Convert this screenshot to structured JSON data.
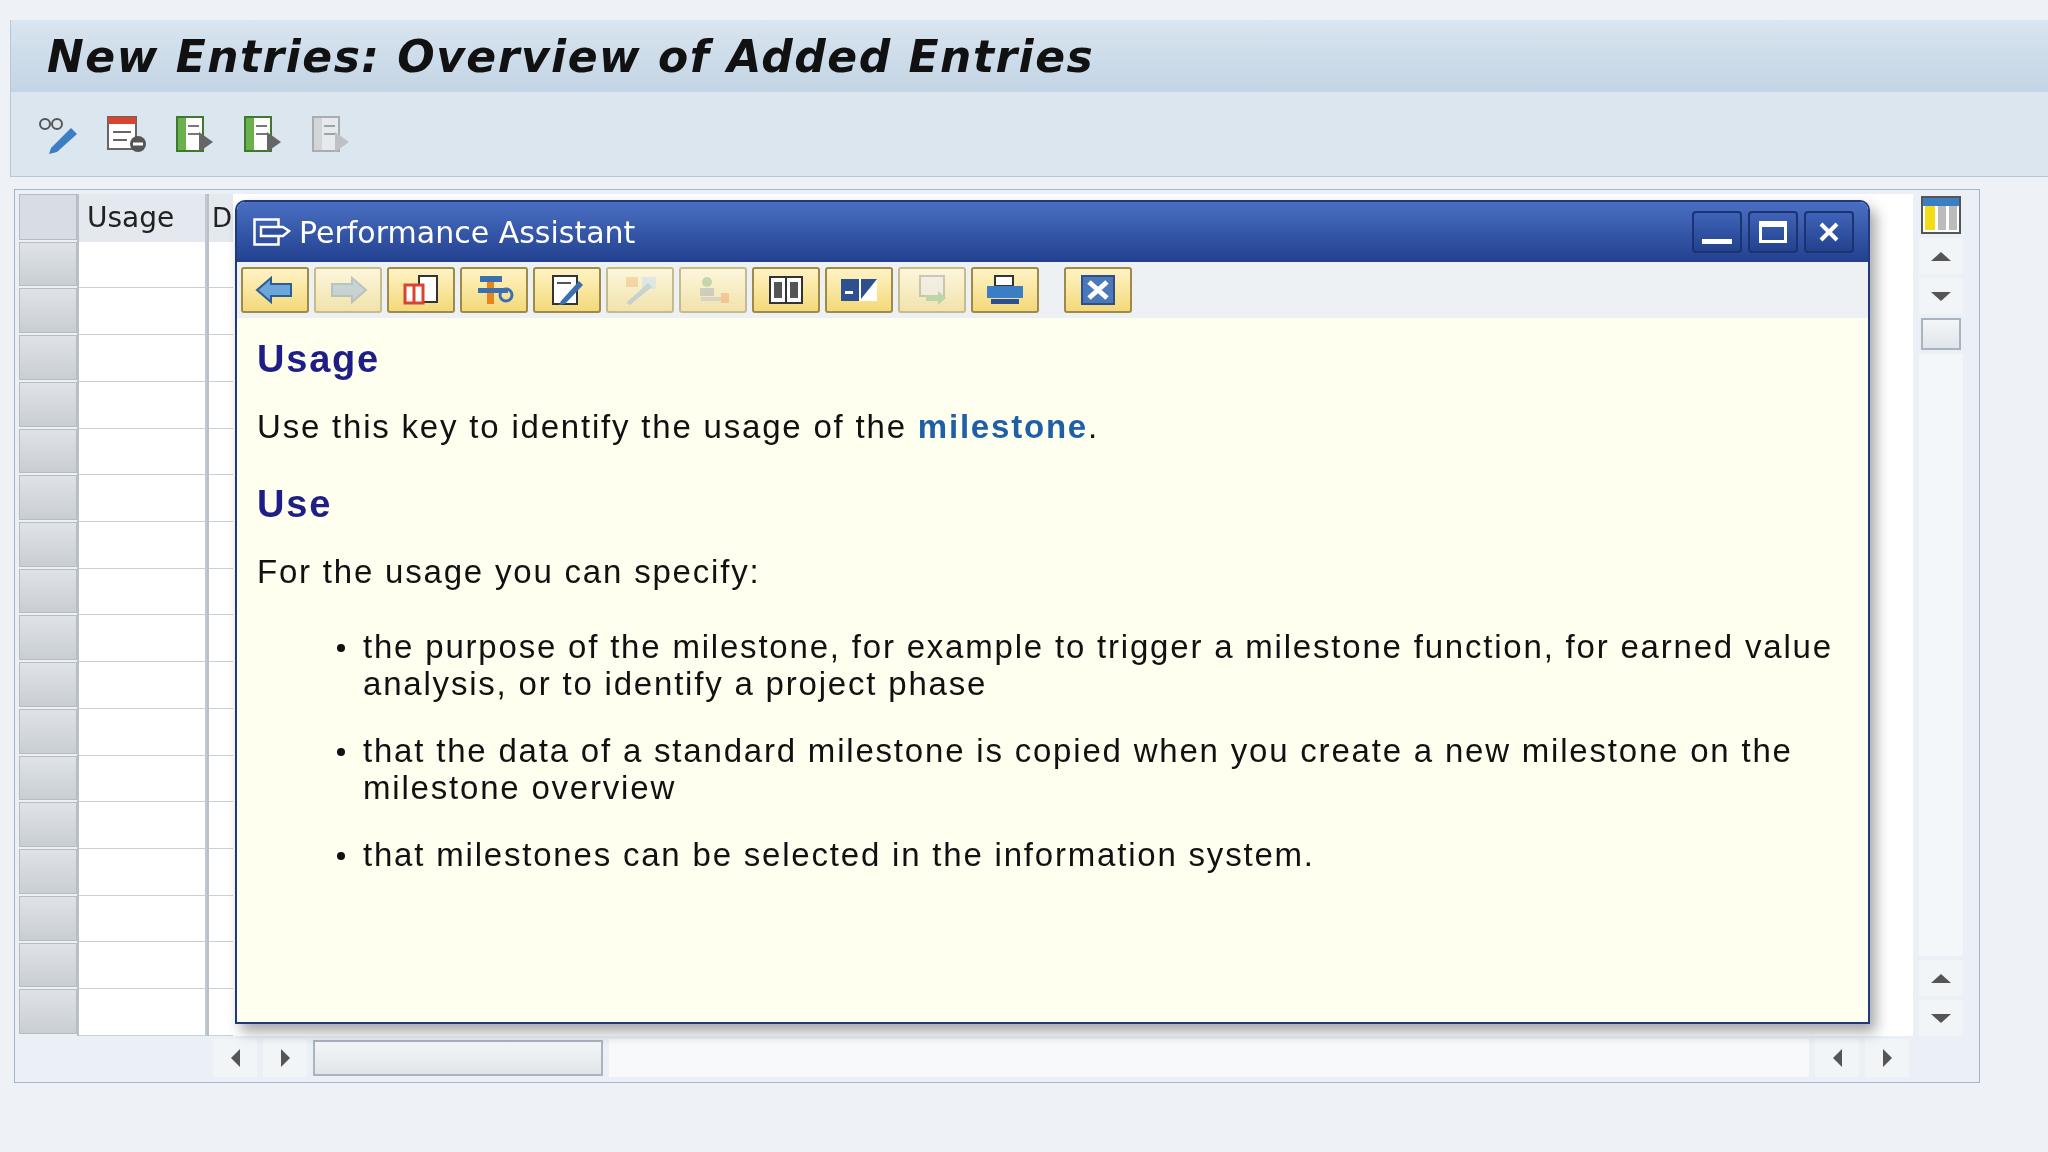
{
  "window": {
    "title": "New Entries: Overview of Added Entries"
  },
  "toolbar": [
    {
      "kind": "glasses-pencil",
      "disabled": false
    },
    {
      "kind": "delete-row",
      "disabled": false
    },
    {
      "kind": "doc-arrow",
      "disabled": false
    },
    {
      "kind": "doc-arrow",
      "disabled": false
    },
    {
      "kind": "doc-arrow",
      "disabled": true
    }
  ],
  "table": {
    "columns": [
      "Usage",
      "D"
    ]
  },
  "popup": {
    "title": "Performance Assistant",
    "toolbar": [
      {
        "kind": "back",
        "disabled": false
      },
      {
        "kind": "forward",
        "disabled": true
      },
      {
        "kind": "book",
        "disabled": false
      },
      {
        "kind": "tools",
        "disabled": false
      },
      {
        "kind": "edit",
        "disabled": false
      },
      {
        "kind": "pen",
        "disabled": true
      },
      {
        "kind": "person-key",
        "disabled": true
      },
      {
        "kind": "ledger",
        "disabled": false
      },
      {
        "kind": "panel",
        "disabled": false
      },
      {
        "kind": "screen-arrow",
        "disabled": true
      },
      {
        "kind": "print",
        "disabled": false
      },
      {
        "kind": "close",
        "disabled": false
      }
    ],
    "content": [
      {
        "kind": "heading",
        "text": "Usage"
      },
      {
        "kind": "paragraph",
        "before": "Use this key to identify the usage of the ",
        "link": "milestone",
        "after": "."
      },
      {
        "kind": "heading",
        "text": "Use"
      },
      {
        "kind": "paragraph",
        "before": "For the usage you can specify:"
      },
      {
        "kind": "bullets",
        "items": [
          "the purpose of the milestone, for example to trigger a milestone function, for earned value analysis, or to identify a project phase",
          "that the data of a standard milestone is copied when you create a new milestone on the milestone overview",
          "that milestones can be selected in the information system."
        ]
      }
    ]
  }
}
